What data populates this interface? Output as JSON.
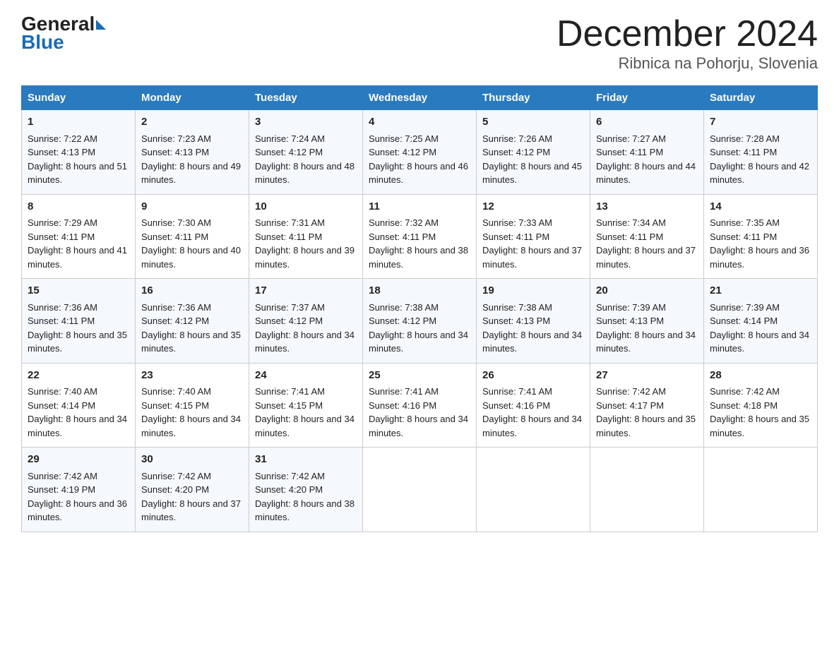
{
  "logo": {
    "general": "General",
    "blue": "Blue"
  },
  "title": "December 2024",
  "location": "Ribnica na Pohorju, Slovenia",
  "days_header": [
    "Sunday",
    "Monday",
    "Tuesday",
    "Wednesday",
    "Thursday",
    "Friday",
    "Saturday"
  ],
  "weeks": [
    [
      {
        "day": "1",
        "sunrise": "7:22 AM",
        "sunset": "4:13 PM",
        "daylight": "8 hours and 51 minutes."
      },
      {
        "day": "2",
        "sunrise": "7:23 AM",
        "sunset": "4:13 PM",
        "daylight": "8 hours and 49 minutes."
      },
      {
        "day": "3",
        "sunrise": "7:24 AM",
        "sunset": "4:12 PM",
        "daylight": "8 hours and 48 minutes."
      },
      {
        "day": "4",
        "sunrise": "7:25 AM",
        "sunset": "4:12 PM",
        "daylight": "8 hours and 46 minutes."
      },
      {
        "day": "5",
        "sunrise": "7:26 AM",
        "sunset": "4:12 PM",
        "daylight": "8 hours and 45 minutes."
      },
      {
        "day": "6",
        "sunrise": "7:27 AM",
        "sunset": "4:11 PM",
        "daylight": "8 hours and 44 minutes."
      },
      {
        "day": "7",
        "sunrise": "7:28 AM",
        "sunset": "4:11 PM",
        "daylight": "8 hours and 42 minutes."
      }
    ],
    [
      {
        "day": "8",
        "sunrise": "7:29 AM",
        "sunset": "4:11 PM",
        "daylight": "8 hours and 41 minutes."
      },
      {
        "day": "9",
        "sunrise": "7:30 AM",
        "sunset": "4:11 PM",
        "daylight": "8 hours and 40 minutes."
      },
      {
        "day": "10",
        "sunrise": "7:31 AM",
        "sunset": "4:11 PM",
        "daylight": "8 hours and 39 minutes."
      },
      {
        "day": "11",
        "sunrise": "7:32 AM",
        "sunset": "4:11 PM",
        "daylight": "8 hours and 38 minutes."
      },
      {
        "day": "12",
        "sunrise": "7:33 AM",
        "sunset": "4:11 PM",
        "daylight": "8 hours and 37 minutes."
      },
      {
        "day": "13",
        "sunrise": "7:34 AM",
        "sunset": "4:11 PM",
        "daylight": "8 hours and 37 minutes."
      },
      {
        "day": "14",
        "sunrise": "7:35 AM",
        "sunset": "4:11 PM",
        "daylight": "8 hours and 36 minutes."
      }
    ],
    [
      {
        "day": "15",
        "sunrise": "7:36 AM",
        "sunset": "4:11 PM",
        "daylight": "8 hours and 35 minutes."
      },
      {
        "day": "16",
        "sunrise": "7:36 AM",
        "sunset": "4:12 PM",
        "daylight": "8 hours and 35 minutes."
      },
      {
        "day": "17",
        "sunrise": "7:37 AM",
        "sunset": "4:12 PM",
        "daylight": "8 hours and 34 minutes."
      },
      {
        "day": "18",
        "sunrise": "7:38 AM",
        "sunset": "4:12 PM",
        "daylight": "8 hours and 34 minutes."
      },
      {
        "day": "19",
        "sunrise": "7:38 AM",
        "sunset": "4:13 PM",
        "daylight": "8 hours and 34 minutes."
      },
      {
        "day": "20",
        "sunrise": "7:39 AM",
        "sunset": "4:13 PM",
        "daylight": "8 hours and 34 minutes."
      },
      {
        "day": "21",
        "sunrise": "7:39 AM",
        "sunset": "4:14 PM",
        "daylight": "8 hours and 34 minutes."
      }
    ],
    [
      {
        "day": "22",
        "sunrise": "7:40 AM",
        "sunset": "4:14 PM",
        "daylight": "8 hours and 34 minutes."
      },
      {
        "day": "23",
        "sunrise": "7:40 AM",
        "sunset": "4:15 PM",
        "daylight": "8 hours and 34 minutes."
      },
      {
        "day": "24",
        "sunrise": "7:41 AM",
        "sunset": "4:15 PM",
        "daylight": "8 hours and 34 minutes."
      },
      {
        "day": "25",
        "sunrise": "7:41 AM",
        "sunset": "4:16 PM",
        "daylight": "8 hours and 34 minutes."
      },
      {
        "day": "26",
        "sunrise": "7:41 AM",
        "sunset": "4:16 PM",
        "daylight": "8 hours and 34 minutes."
      },
      {
        "day": "27",
        "sunrise": "7:42 AM",
        "sunset": "4:17 PM",
        "daylight": "8 hours and 35 minutes."
      },
      {
        "day": "28",
        "sunrise": "7:42 AM",
        "sunset": "4:18 PM",
        "daylight": "8 hours and 35 minutes."
      }
    ],
    [
      {
        "day": "29",
        "sunrise": "7:42 AM",
        "sunset": "4:19 PM",
        "daylight": "8 hours and 36 minutes."
      },
      {
        "day": "30",
        "sunrise": "7:42 AM",
        "sunset": "4:20 PM",
        "daylight": "8 hours and 37 minutes."
      },
      {
        "day": "31",
        "sunrise": "7:42 AM",
        "sunset": "4:20 PM",
        "daylight": "8 hours and 38 minutes."
      },
      null,
      null,
      null,
      null
    ]
  ],
  "labels": {
    "sunrise_prefix": "Sunrise: ",
    "sunset_prefix": "Sunset: ",
    "daylight_prefix": "Daylight: "
  }
}
